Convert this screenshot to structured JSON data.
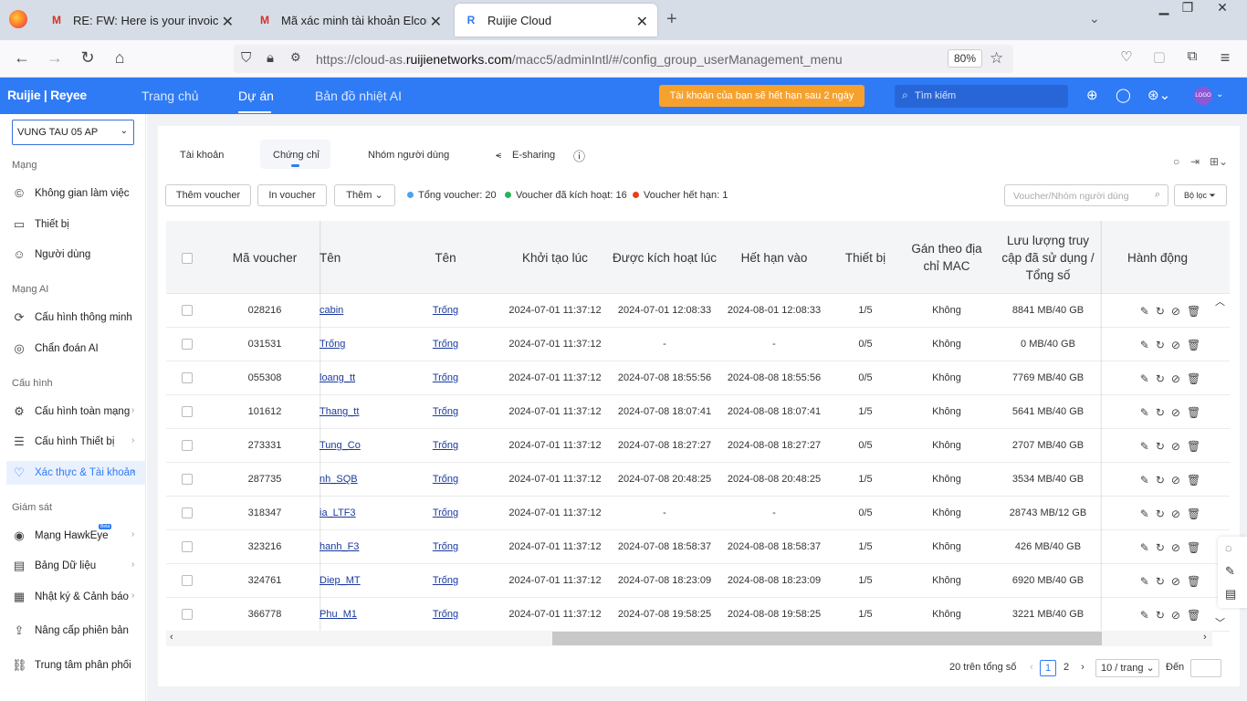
{
  "browser": {
    "tabs": [
      {
        "title": "RE: FW: Here is your invoice CR",
        "icon": "gmail-icon"
      },
      {
        "title": "Mã xác minh tài khoản Elcome",
        "icon": "gmail-icon"
      },
      {
        "title": "Ruijie Cloud",
        "icon": "ruijie-icon"
      }
    ],
    "url_prefix": "https://cloud-as.",
    "url_domain": "ruijienetworks.com",
    "url_path": "/macc5/adminIntl/#/config_group_userManagement_menu",
    "zoom": "80%"
  },
  "header": {
    "logo": "Ruijie | Reyee",
    "nav": [
      "Trang chủ",
      "Dự án",
      "Bản đồ nhiệt AI"
    ],
    "active_nav": "Dự án",
    "expire_banner": "Tài khoản của bạn sẽ hết hạn sau 2 ngày",
    "search_placeholder": "Tìm kiếm",
    "avatar_text": "LOGO"
  },
  "sidebar": {
    "site": "VUNG TAU 05 AP",
    "sections": {
      "network": "Mạng",
      "ai": "Mạng AI",
      "config": "Cấu hình",
      "monitor": "Giám sát"
    },
    "items": {
      "workspace": "Không gian làm việc",
      "devices": "Thiết bị",
      "users": "Người dùng",
      "smart_config": "Cấu hình thông minh",
      "ai_diagnosis": "Chẩn đoán AI",
      "network_config": "Cấu hình toàn mạng",
      "device_config": "Cấu hình Thiết bị",
      "auth": "Xác thực & Tài khoản",
      "hawkeye": "Mạng HawkEye",
      "dashboard": "Bảng Dữ liệu",
      "logs": "Nhật ký & Cảnh báo",
      "upgrade": "Nâng cấp phiên bản",
      "distribution": "Trung tâm phân phối"
    },
    "beta_label": "Beta"
  },
  "page": {
    "tabs": [
      "Tài khoản",
      "Chứng chỉ",
      "Nhóm người dùng",
      "E-sharing"
    ],
    "active_tab": "Chứng chỉ",
    "buttons": {
      "add_voucher": "Thêm voucher",
      "print_voucher": "In voucher",
      "more": "Thêm"
    },
    "stats": {
      "total": "Tổng voucher: 20",
      "activated": "Voucher đã kích hoạt: 16",
      "expired": "Voucher hết hạn: 1"
    },
    "stat_colors": {
      "total": "#4da3f0",
      "activated": "#29b35a",
      "expired": "#e8401c"
    },
    "search_placeholder": "Voucher/Nhóm người dùng",
    "filter_label": "Bộ lọc"
  },
  "table": {
    "columns": [
      "Mã voucher",
      "Tên",
      "Tên",
      "Khởi tạo lúc",
      "Được kích hoạt lúc",
      "Hết hạn vào",
      "Thiết bị",
      "Gán theo địa chỉ MAC",
      "Lưu lượng truy cập đã sử dụng / Tổng số",
      "Hành động"
    ],
    "rows": [
      {
        "code": "028216",
        "name": "cabin",
        "group": "Trống",
        "created": "2024-07-01 11:37:12",
        "activated": "2024-07-01 12:08:33",
        "expires": "2024-08-01 12:08:33",
        "devices": "1/5",
        "mac": "Không",
        "traffic": "8841 MB/40 GB"
      },
      {
        "code": "031531",
        "name": "Trống",
        "group": "Trống",
        "created": "2024-07-01 11:37:12",
        "activated": "-",
        "expires": "-",
        "devices": "0/5",
        "mac": "Không",
        "traffic": "0 MB/40 GB"
      },
      {
        "code": "055308",
        "name": "loang_tt",
        "group": "Trống",
        "created": "2024-07-01 11:37:12",
        "activated": "2024-07-08 18:55:56",
        "expires": "2024-08-08 18:55:56",
        "devices": "0/5",
        "mac": "Không",
        "traffic": "7769 MB/40 GB"
      },
      {
        "code": "101612",
        "name": "Thang_tt",
        "group": "Trống",
        "created": "2024-07-01 11:37:12",
        "activated": "2024-07-08 18:07:41",
        "expires": "2024-08-08 18:07:41",
        "devices": "1/5",
        "mac": "Không",
        "traffic": "5641 MB/40 GB"
      },
      {
        "code": "273331",
        "name": "Tung_Co",
        "group": "Trống",
        "created": "2024-07-01 11:37:12",
        "activated": "2024-07-08 18:27:27",
        "expires": "2024-08-08 18:27:27",
        "devices": "0/5",
        "mac": "Không",
        "traffic": "2707 MB/40 GB"
      },
      {
        "code": "287735",
        "name": "nh_SQB",
        "group": "Trống",
        "created": "2024-07-01 11:37:12",
        "activated": "2024-07-08 20:48:25",
        "expires": "2024-08-08 20:48:25",
        "devices": "1/5",
        "mac": "Không",
        "traffic": "3534 MB/40 GB"
      },
      {
        "code": "318347",
        "name": "ia_LTF3",
        "group": "Trống",
        "created": "2024-07-01 11:37:12",
        "activated": "-",
        "expires": "-",
        "devices": "0/5",
        "mac": "Không",
        "traffic": "28743 MB/12 GB"
      },
      {
        "code": "323216",
        "name": "hanh_F3",
        "group": "Trống",
        "created": "2024-07-01 11:37:12",
        "activated": "2024-07-08 18:58:37",
        "expires": "2024-08-08 18:58:37",
        "devices": "1/5",
        "mac": "Không",
        "traffic": "426 MB/40 GB"
      },
      {
        "code": "324761",
        "name": "Diep_MT",
        "group": "Trống",
        "created": "2024-07-01 11:37:12",
        "activated": "2024-07-08 18:23:09",
        "expires": "2024-08-08 18:23:09",
        "devices": "1/5",
        "mac": "Không",
        "traffic": "6920 MB/40 GB"
      },
      {
        "code": "366778",
        "name": "Phu_M1",
        "group": "Trống",
        "created": "2024-07-01 11:37:12",
        "activated": "2024-07-08 19:58:25",
        "expires": "2024-08-08 19:58:25",
        "devices": "1/5",
        "mac": "Không",
        "traffic": "3221 MB/40 GB"
      }
    ]
  },
  "pagination": {
    "total": "20 trên tổng số",
    "pages": [
      "1",
      "2"
    ],
    "current": "1",
    "page_size": "10 / trang",
    "goto_label": "Đến"
  },
  "colors": {
    "brand": "#2f7bf5",
    "banner": "#f7a12d"
  }
}
